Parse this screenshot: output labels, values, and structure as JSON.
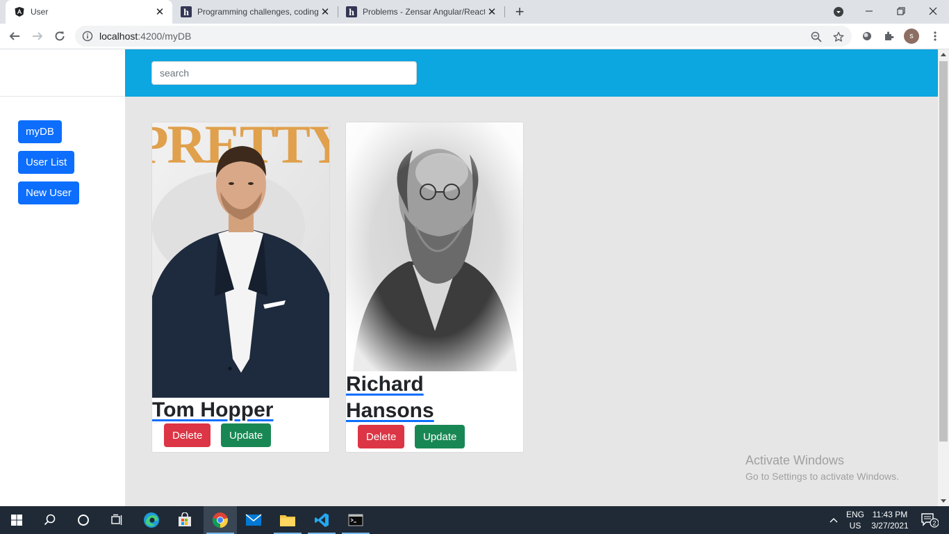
{
  "browser": {
    "tabs": [
      {
        "title": "User",
        "favicon": "angular-icon",
        "active": true
      },
      {
        "title": "Programming challenges, coding",
        "favicon": "hackerearth-icon",
        "active": false
      },
      {
        "title": "Problems - Zensar Angular/React",
        "favicon": "hackerearth-icon",
        "active": false
      }
    ],
    "url_host": "localhost",
    "url_path": ":4200/myDB",
    "profile_initial": "s"
  },
  "app": {
    "search_placeholder": "search",
    "nav": [
      {
        "label": "myDB"
      },
      {
        "label": "User List"
      },
      {
        "label": "New User"
      }
    ],
    "users": [
      {
        "name": "Tom Hopper",
        "delete_label": "Delete",
        "update_label": "Update"
      },
      {
        "name": "Richard Hansons",
        "name_line1": "Richard",
        "name_line2": "Hansons",
        "delete_label": "Delete",
        "update_label": "Update"
      }
    ]
  },
  "watermark": {
    "line1": "Activate Windows",
    "line2": "Go to Settings to activate Windows."
  },
  "taskbar": {
    "lang_line1": "ENG",
    "lang_line2": "US",
    "time": "11:43 PM",
    "date": "3/27/2021",
    "notification_count": "2"
  },
  "colors": {
    "header": "#0ca6e0",
    "primary": "#0d6efd",
    "danger": "#dc3545",
    "success": "#198754"
  }
}
